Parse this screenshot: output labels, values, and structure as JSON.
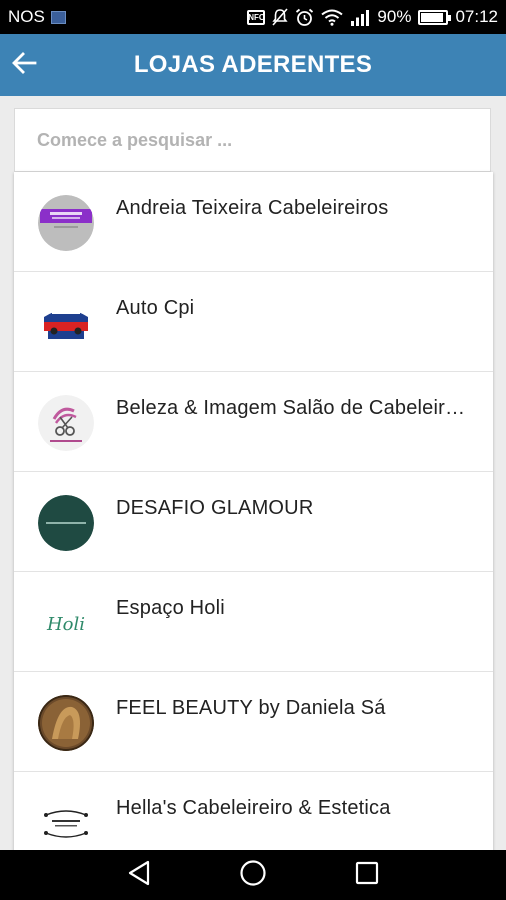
{
  "status_bar": {
    "carrier": "NOS",
    "battery_percent": "90%",
    "battery_level": 0.9,
    "time": "07:12",
    "nfc_label": "NFC",
    "icons": [
      "image-icon",
      "nfc-icon",
      "mute-icon",
      "alarm-icon",
      "wifi-icon",
      "signal-icon",
      "battery-icon"
    ]
  },
  "header": {
    "title": "LOJAS ADERENTES",
    "back_icon": "arrow-left-icon",
    "color": "#3d83b5"
  },
  "search": {
    "placeholder": "Comece a pesquisar ...",
    "value": ""
  },
  "stores": [
    {
      "name": "Andreia Teixeira Cabeleireiros",
      "logo": "andreia-logo"
    },
    {
      "name": "Auto Cpi",
      "logo": "auto-cpi-logo"
    },
    {
      "name": "Beleza & Imagem Salão de Cabeleireiro",
      "logo": "beleza-imagem-logo"
    },
    {
      "name": "DESAFIO GLAMOUR",
      "logo": "desafio-glamour-logo"
    },
    {
      "name": "Espaço Holi",
      "logo": "espaco-holi-logo",
      "logo_text": "Holi"
    },
    {
      "name": "FEEL BEAUTY by Daniela Sá",
      "logo": "feel-beauty-logo"
    },
    {
      "name": "Hella's Cabeleireiro & Estetica",
      "logo": "hellas-logo"
    }
  ],
  "nav_bar": {
    "buttons": [
      "back-triangle-icon",
      "home-circle-icon",
      "recents-square-icon"
    ]
  }
}
